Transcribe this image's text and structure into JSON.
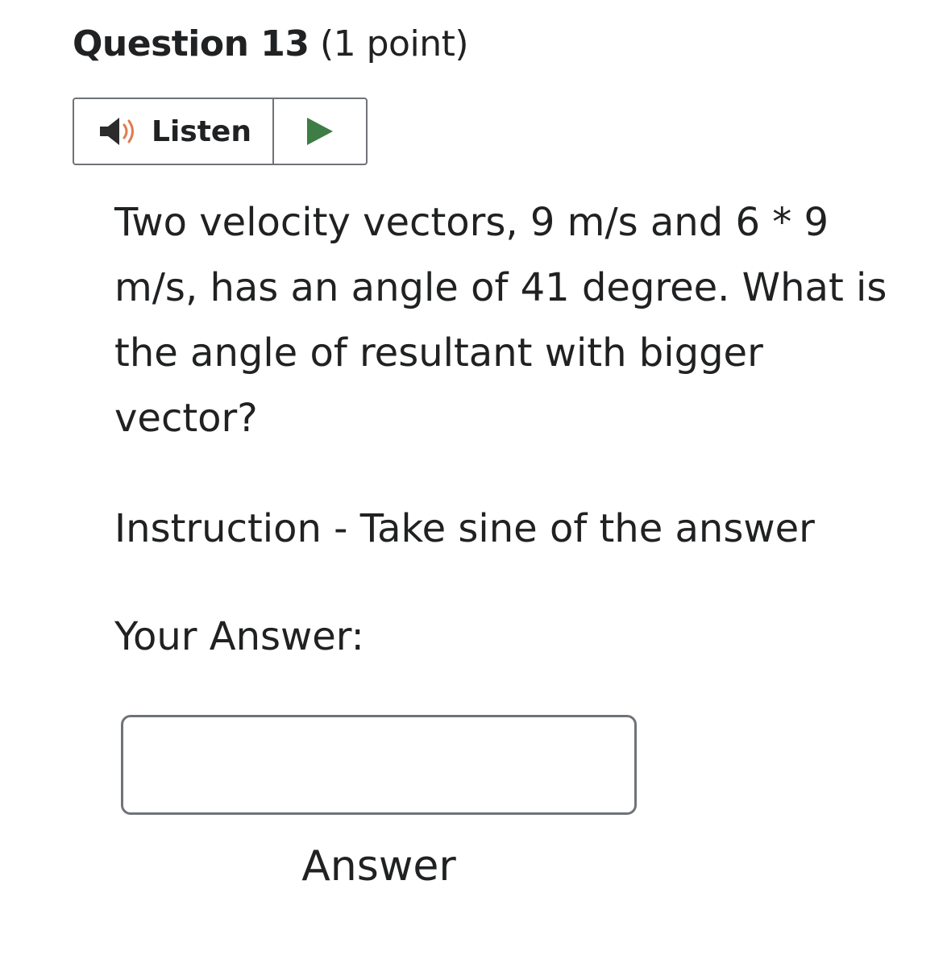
{
  "question": {
    "title": "Question 13",
    "points": "(1 point)",
    "text": "Two velocity vectors, 9 m/s and 6 * 9 m/s, has an angle of 41 degree. What is the angle of resultant with bigger vector?",
    "instruction": "Instruction - Take sine of the answer"
  },
  "listen": {
    "label": "Listen",
    "speaker_icon": "speaker-icon",
    "play_icon": "play-icon",
    "accent_speaker": "#e07b4f",
    "accent_play": "#3e7d45"
  },
  "answer": {
    "heading": "Your Answer:",
    "value": "",
    "caption": "Answer"
  }
}
